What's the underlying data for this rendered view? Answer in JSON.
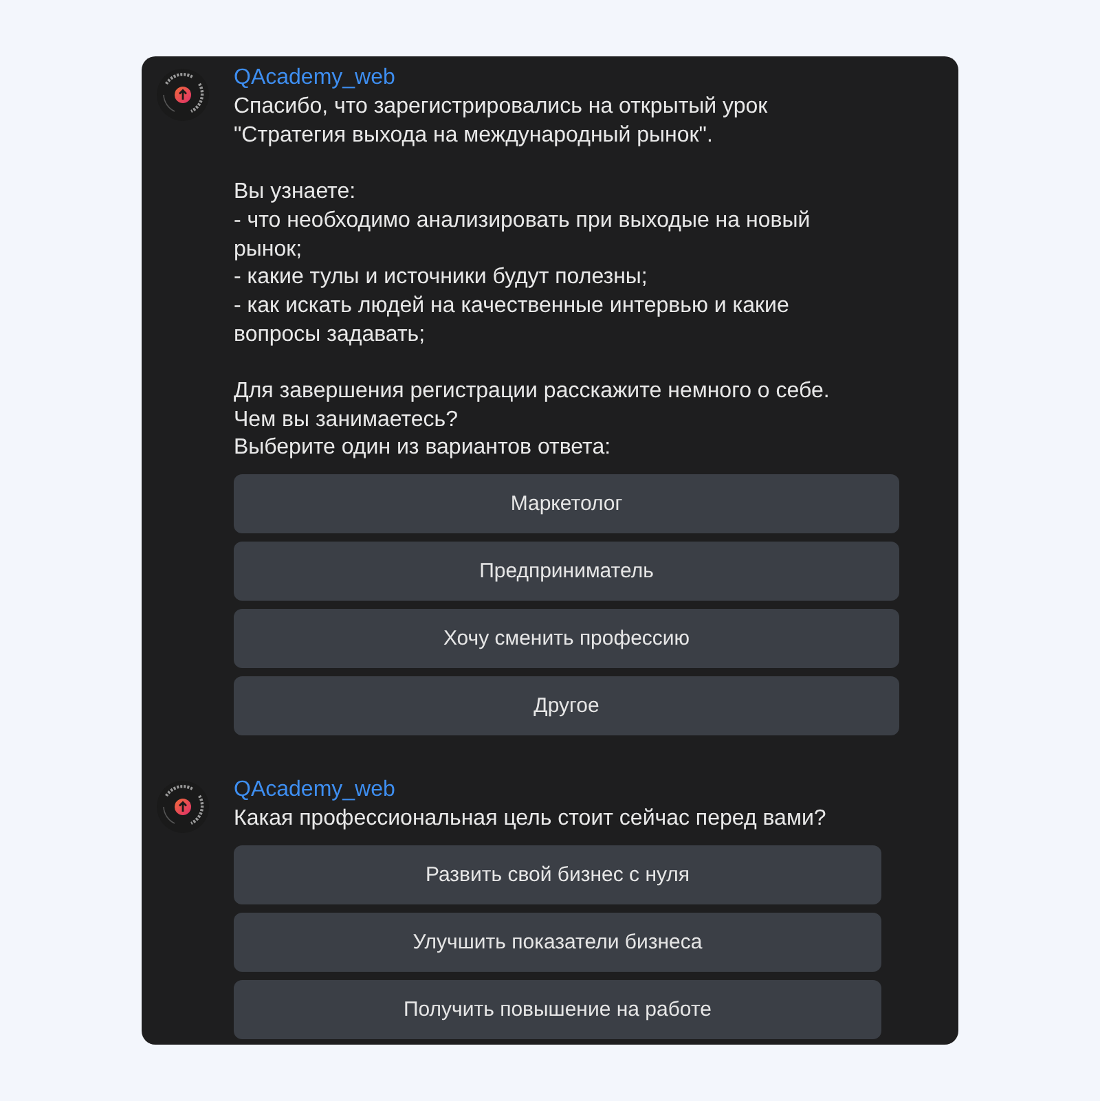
{
  "messages": [
    {
      "sender": "QAcademy_web",
      "text": "Спасибо, что зарегистрировались на открытый урок\n\"Стратегия выхода на международный рынок\".\n\nВы узнаете:\n- что необходимо анализировать при выходые на новый\nрынок;\n- какие тулы и источники будут полезны;\n- как искать людей на качественные интервью и какие\nвопросы задавать;\n\nДля завершения регистрации расскажите немного о себе.\nЧем вы занимаетесь?\nВыберите один из вариантов ответа:",
      "buttons": [
        "Маркетолог",
        "Предприниматель",
        "Хочу сменить профессию",
        "Другое"
      ]
    },
    {
      "sender": "QAcademy_web",
      "text": "Какая профессиональная цель стоит сейчас перед вами?",
      "buttons": [
        "Развить свой бизнес с нуля",
        "Улучшить показатели бизнеса",
        "Получить повышение на работе"
      ]
    }
  ]
}
